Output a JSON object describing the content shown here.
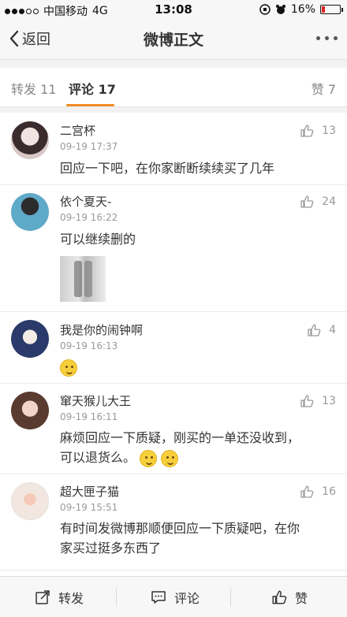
{
  "status_bar": {
    "carrier": "中国移动",
    "network": "4G",
    "time": "13:08",
    "battery": "16%",
    "battery_level": 0.16,
    "battery_color": "#e02020"
  },
  "nav": {
    "back_label": "返回",
    "title": "微博正文",
    "icons": [
      "chevron-left-icon",
      "more-icon"
    ]
  },
  "tabs": [
    {
      "label": "转发 11"
    },
    {
      "label": "评论 17"
    },
    {
      "label": "赞 7"
    }
  ],
  "accent_color": "#f08a24",
  "comments": [
    {
      "name": "二宫杯",
      "time": "09-19 17:37",
      "text": "回应一下吧，在你家断断续续买了几年",
      "likes": "13"
    },
    {
      "name": "依个夏天-",
      "time": "09-19 16:22",
      "text": "可以继续删的",
      "likes": "24"
    },
    {
      "name": "我是你的闹钟啊",
      "time": "09-19 16:13",
      "likes": "4"
    },
    {
      "name": "窜天猴儿大王",
      "time": "09-19 16:11",
      "text": "麻烦回应一下质疑，刚买的一单还没收到，",
      "text2": "可以退货么。",
      "likes": "13"
    },
    {
      "name": "超大匣子猫",
      "time": "09-19 15:51",
      "text": "有时间发微博那顺便回应一下质疑吧，在你",
      "text2": "家买过挺多东西了",
      "likes": "16"
    }
  ],
  "bottom_bar": {
    "repost": "转发",
    "comment": "评论",
    "like": "赞"
  }
}
